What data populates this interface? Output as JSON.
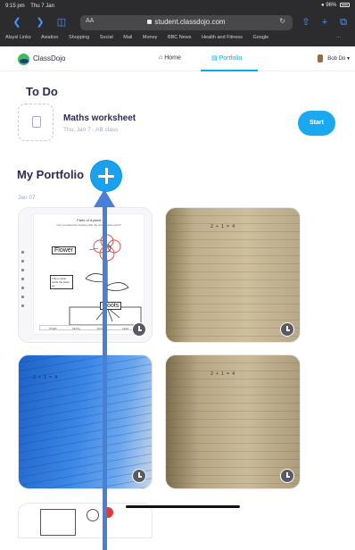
{
  "status_bar": {
    "time": "9:15 pm",
    "date": "Thu 7 Jan",
    "battery": "96%"
  },
  "browser": {
    "text_size": "AA",
    "url": "student.classdojo.com",
    "bookmarks": [
      "Alsysl Links",
      "Aviation",
      "Shopping",
      "Social",
      "Mail",
      "Money",
      "BBC News",
      "Health and Fitness",
      "Google"
    ],
    "bookmarks_more": "···"
  },
  "nav": {
    "brand": "ClassDojo",
    "home": "Home",
    "portfolio": "Portfolio",
    "user": "Bob Do"
  },
  "todo": {
    "title": "To Do",
    "item_title": "Maths worksheet",
    "item_meta": "Thu, Jan 7  ·  AB class",
    "start_label": "Start"
  },
  "portfolio": {
    "title": "My Portfolio",
    "date": "Jan 07",
    "worksheet": {
      "title": "Parts of a plant",
      "subtitle": "Can you label the drawing with the correct plant parts?",
      "label_flower": "Flower",
      "label_roots": "Roots",
      "note": "This is what holds the plant up",
      "footer": [
        "STEM",
        "PETAL",
        "ROOTS",
        "LEAF"
      ]
    },
    "handwriting": [
      "2 + 1 = 4",
      "2 + 1 = 4",
      "2 + 1 = 4"
    ]
  },
  "annotation": {
    "arrow_color": "#4a7fd6"
  },
  "colors": {
    "accent": "#1aa9f0",
    "heading": "#2c2a50",
    "muted": "#a3a8c4"
  }
}
